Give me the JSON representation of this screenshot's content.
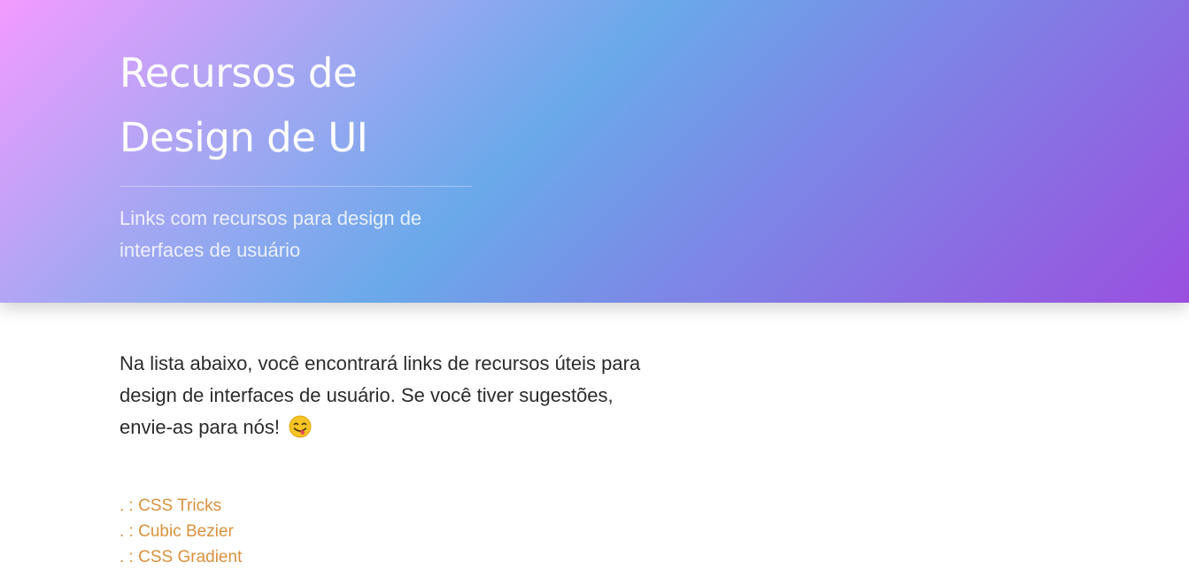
{
  "hero": {
    "title": "Recursos de\nDesign de UI",
    "subtitle": "Links com recursos para design de interfaces de usuário"
  },
  "main": {
    "intro": "Na lista abaixo, você encontrará links de recursos úteis para design de interfaces de usuário. Se você tiver sugestões, envie-as para nós!",
    "intro_emoji_icon": "face-savoring-food-icon",
    "link_prefix": ". : ",
    "links": [
      {
        "label": "CSS Tricks"
      },
      {
        "label": "Cubic Bezier"
      },
      {
        "label": "CSS Gradient"
      }
    ]
  },
  "colors": {
    "link": "#d9913c",
    "text": "#2b2b2b",
    "hero_gradient": [
      "#f39bff",
      "#6aa9ea",
      "#9a4fdf"
    ]
  }
}
